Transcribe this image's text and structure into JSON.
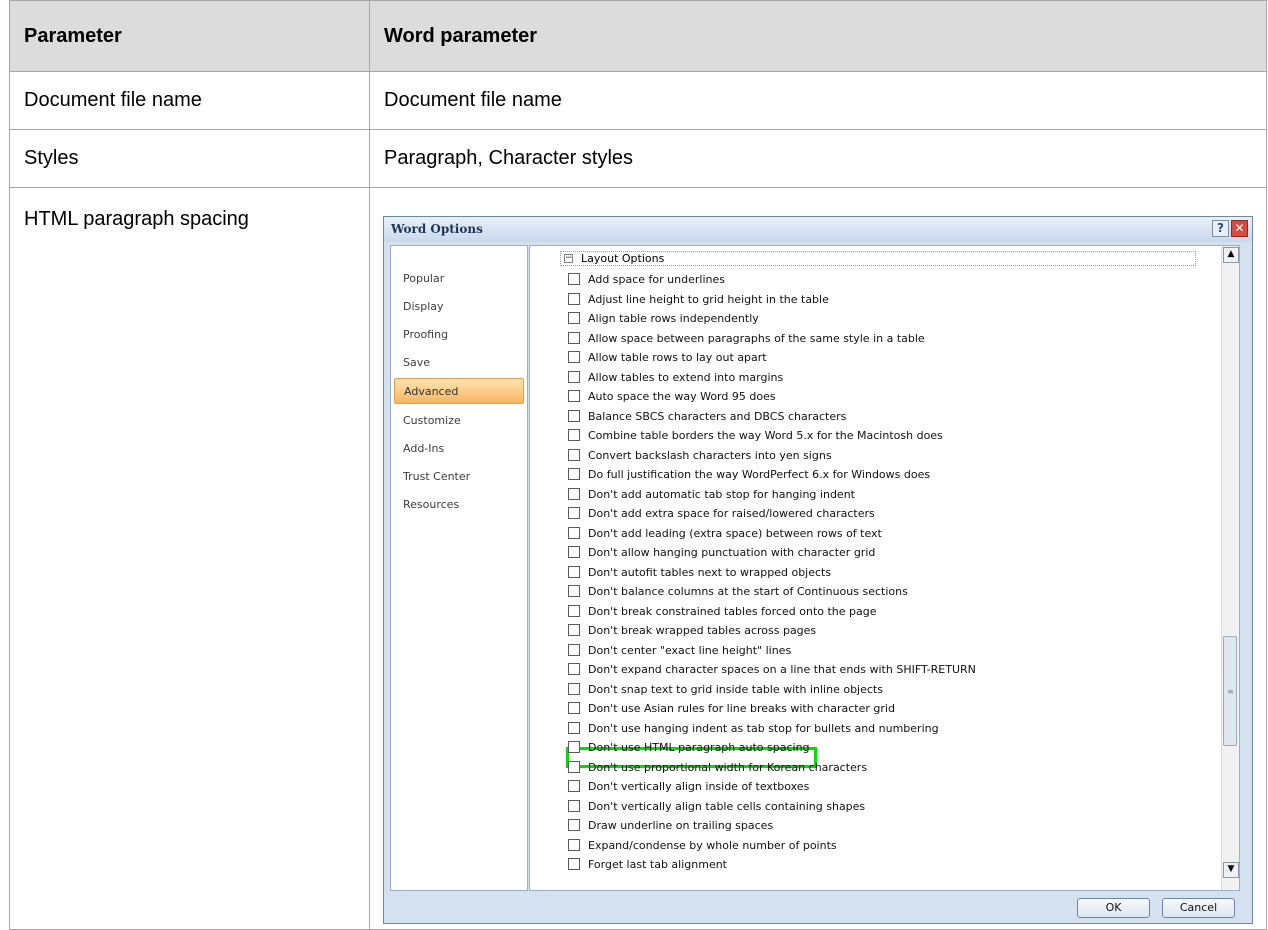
{
  "table": {
    "headers": [
      "Parameter",
      "Word parameter"
    ],
    "rows": [
      [
        "Document file name",
        "Document file name"
      ],
      [
        "Styles",
        "Paragraph, Character styles"
      ],
      [
        "HTML paragraph spacing",
        ""
      ]
    ]
  },
  "dialog": {
    "title": "Word Options",
    "help_label": "?",
    "close_label": "✕",
    "nav_items": [
      "Popular",
      "Display",
      "Proofing",
      "Save",
      "Advanced",
      "Customize",
      "Add-Ins",
      "Trust Center",
      "Resources"
    ],
    "active_nav": "Advanced",
    "section_title": "Layout Options",
    "collapse_glyph": "−",
    "options": [
      "Add space for underlines",
      "Adjust line height to grid height in the table",
      "Align table rows independently",
      "Allow space between paragraphs of the same style in a table",
      "Allow table rows to lay out apart",
      "Allow tables to extend into margins",
      "Auto space the way Word 95 does",
      "Balance SBCS characters and DBCS characters",
      "Combine table borders the way Word 5.x for the Macintosh does",
      "Convert backslash characters into yen signs",
      "Do full justification the way WordPerfect 6.x for Windows does",
      "Don't add automatic tab stop for hanging indent",
      "Don't add extra space for raised/lowered characters",
      "Don't add leading (extra space) between rows of text",
      "Don't allow hanging punctuation with character grid",
      "Don't autofit tables next to wrapped objects",
      "Don't balance columns at the start of Continuous sections",
      "Don't break constrained tables forced onto the page",
      "Don't break wrapped tables across pages",
      "Don't center \"exact line height\" lines",
      "Don't expand character spaces on a line that ends with SHIFT-RETURN",
      "Don't snap text to grid inside table with inline objects",
      "Don't use Asian rules for line breaks with character grid",
      "Don't use hanging indent as tab stop for bullets and numbering",
      "Don't use HTML paragraph auto spacing",
      "Don't use proportional width for Korean characters",
      "Don't vertically align inside of textboxes",
      "Don't vertically align table cells containing shapes",
      "Draw underline on trailing spaces",
      "Expand/condense by whole number of points",
      "Forget last tab alignment"
    ],
    "highlighted_option": "Don't use HTML paragraph auto spacing",
    "highlight_color": "#00e000",
    "scroll_up_glyph": "▲",
    "scroll_down_glyph": "▼",
    "ok_label": "OK",
    "cancel_label": "Cancel"
  }
}
